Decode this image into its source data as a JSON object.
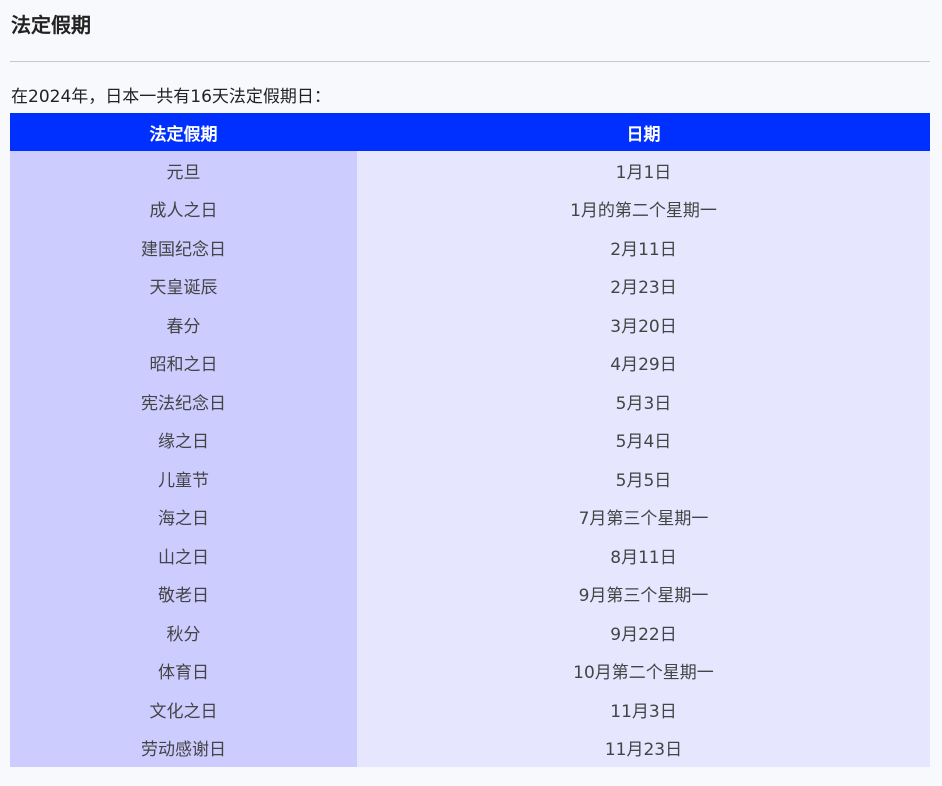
{
  "heading": "法定假期",
  "intro": "在2024年，日本一共有16天法定假期日：",
  "table": {
    "headers": [
      "法定假期",
      "日期"
    ],
    "rows": [
      [
        "元旦",
        "1月1日"
      ],
      [
        "成人之日",
        "1月的第二个星期一"
      ],
      [
        "建国纪念日",
        "2月11日"
      ],
      [
        "天皇诞辰",
        "2月23日"
      ],
      [
        "春分",
        "3月20日"
      ],
      [
        "昭和之日",
        "4月29日"
      ],
      [
        "宪法纪念日",
        "5月3日"
      ],
      [
        "缘之日",
        "5月4日"
      ],
      [
        "儿童节",
        "5月5日"
      ],
      [
        "海之日",
        "7月第三个星期一"
      ],
      [
        "山之日",
        "8月11日"
      ],
      [
        "敬老日",
        "9月第三个星期一"
      ],
      [
        "秋分",
        "9月22日"
      ],
      [
        "体育日",
        "10月第二个星期一"
      ],
      [
        "文化之日",
        "11月3日"
      ],
      [
        "劳动感谢日",
        "11月23日"
      ]
    ]
  },
  "colors": {
    "header_bg": "#0030ff",
    "name_col_bg": "#ccccff",
    "date_col_bg": "#e6e6fe",
    "page_bg": "#f8f9fd"
  }
}
